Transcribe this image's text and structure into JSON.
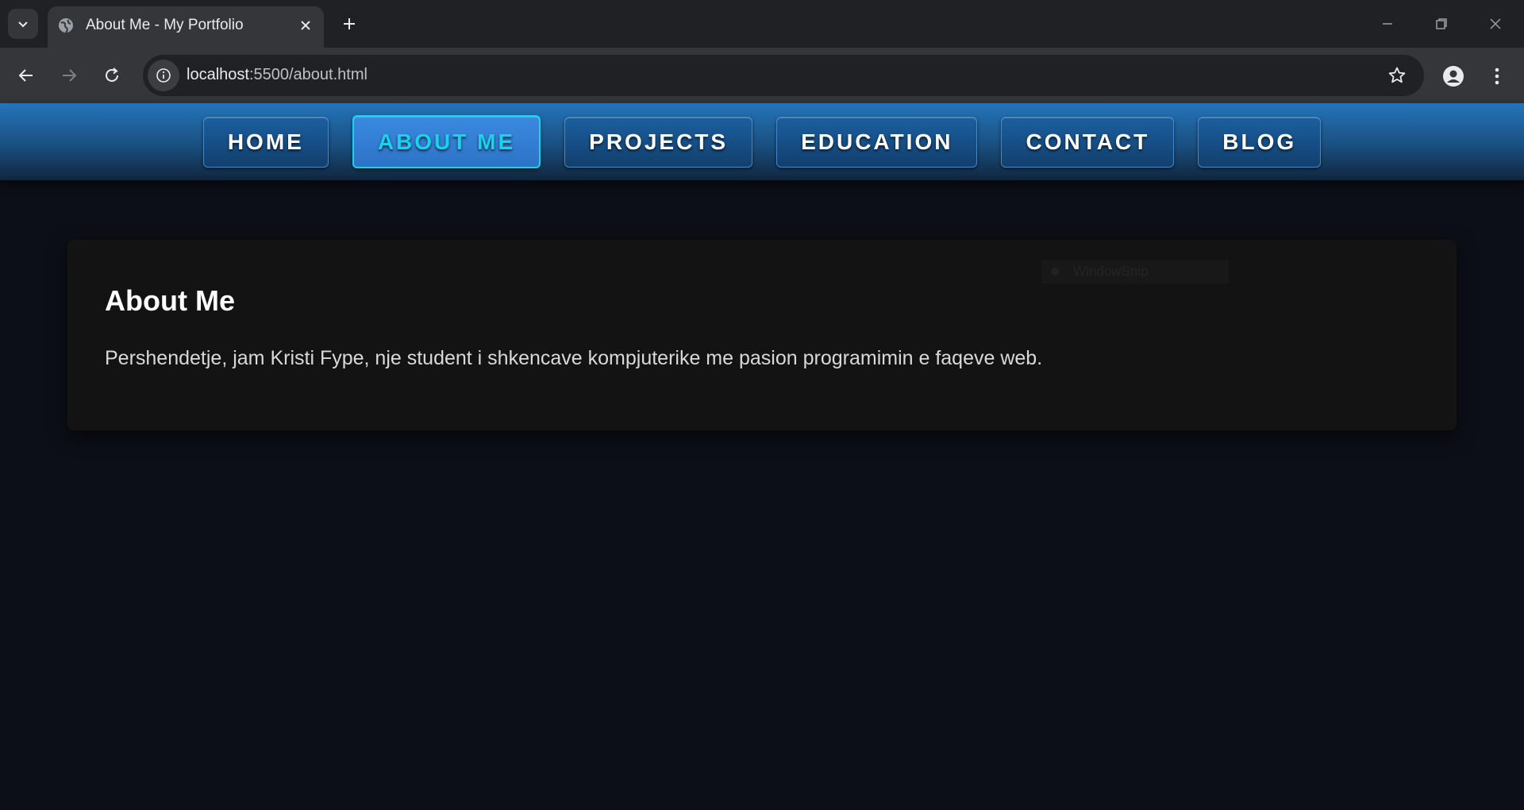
{
  "browser": {
    "tab": {
      "title": "About Me - My Portfolio"
    },
    "address": {
      "host": "localhost",
      "path": ":5500/about.html"
    }
  },
  "nav": {
    "items": [
      {
        "label": "HOME",
        "active": false
      },
      {
        "label": "ABOUT ME",
        "active": true
      },
      {
        "label": "PROJECTS",
        "active": false
      },
      {
        "label": "EDUCATION",
        "active": false
      },
      {
        "label": "CONTACT",
        "active": false
      },
      {
        "label": "BLOG",
        "active": false
      }
    ]
  },
  "about": {
    "heading": "About Me",
    "text": "Pershendetje, jam Kristi Fype, nje student i shkencave kompjuterike me pasion programimin e faqeve web."
  },
  "overlay": {
    "label": "WindowSnip"
  },
  "colors": {
    "accent": "#19d3ee",
    "nav_top": "#2474b9",
    "page_bg": "#0c0f17",
    "card_bg": "#131313"
  }
}
